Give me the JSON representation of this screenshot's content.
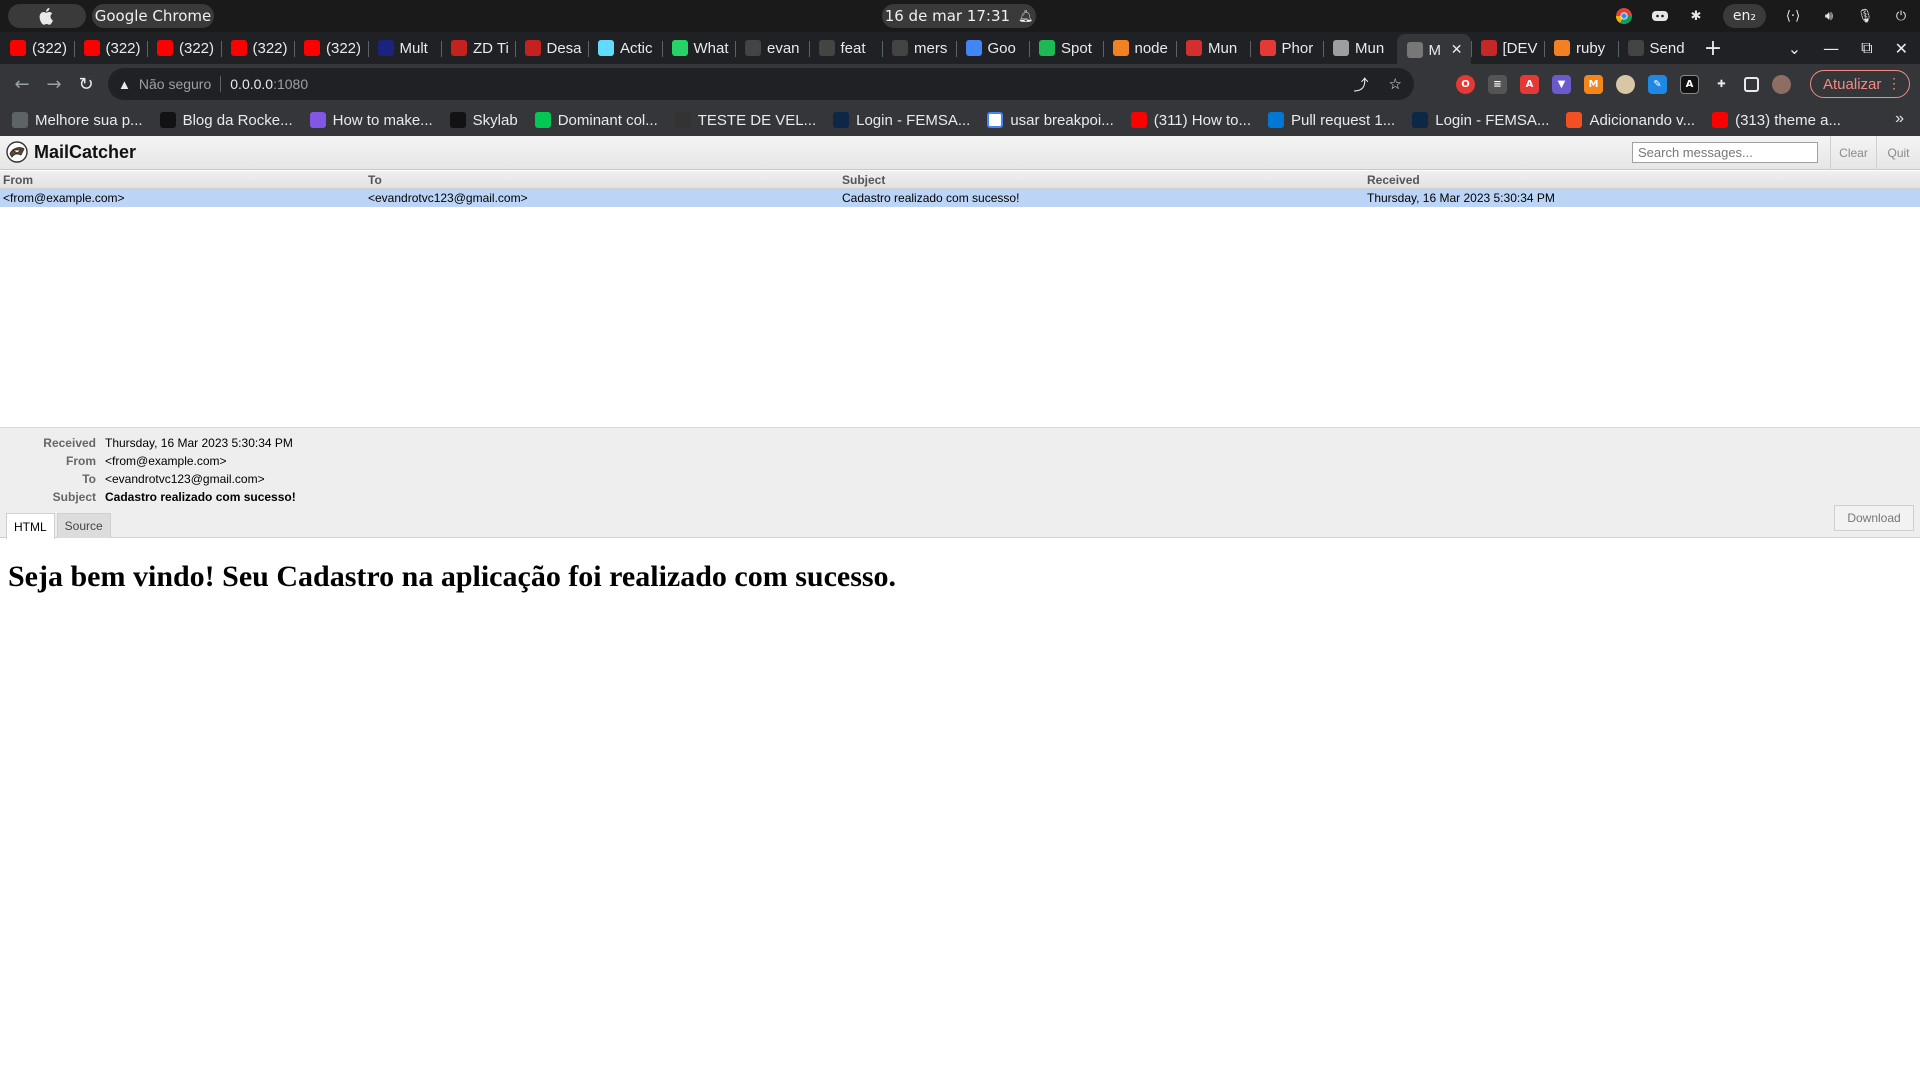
{
  "os_bar": {
    "app_name": "Google Chrome",
    "clock": "16 de mar  17:31",
    "language": "en₂"
  },
  "tabs": [
    {
      "label": "(322)",
      "icon": "youtube-icon",
      "color": "#ff0000"
    },
    {
      "label": "(322)",
      "icon": "youtube-icon",
      "color": "#ff0000"
    },
    {
      "label": "(322)",
      "icon": "youtube-icon",
      "color": "#ff0000"
    },
    {
      "label": "(322)",
      "icon": "youtube-icon",
      "color": "#ff0000"
    },
    {
      "label": "(322)",
      "icon": "youtube-icon",
      "color": "#ff0000"
    },
    {
      "label": "Mult",
      "icon": "m-icon",
      "color": "#1a237e"
    },
    {
      "label": "ZD Ti",
      "icon": "gmail-icon",
      "color": "#c5221f"
    },
    {
      "label": "Desa",
      "icon": "gmail-icon",
      "color": "#c5221f"
    },
    {
      "label": "Actic",
      "icon": "react-icon",
      "color": "#61dafb"
    },
    {
      "label": "What",
      "icon": "whatsapp-icon",
      "color": "#25d366"
    },
    {
      "label": "evan",
      "icon": "github-icon",
      "color": "#444444"
    },
    {
      "label": "feat",
      "icon": "github-icon",
      "color": "#444444"
    },
    {
      "label": "mers",
      "icon": "github-icon",
      "color": "#444444"
    },
    {
      "label": "Goo",
      "icon": "translate-icon",
      "color": "#4285f4"
    },
    {
      "label": "Spot",
      "icon": "spotify-icon",
      "color": "#1db954"
    },
    {
      "label": "node",
      "icon": "stackoverflow-icon",
      "color": "#f48024"
    },
    {
      "label": "Mun",
      "icon": "mun-icon",
      "color": "#d32f2f"
    },
    {
      "label": "Phor",
      "icon": "phone-icon",
      "color": "#e53935"
    },
    {
      "label": "Mun",
      "icon": "globe-icon",
      "color": "#9e9e9e"
    },
    {
      "label": "M",
      "icon": "mailcatcher-icon",
      "color": "#777777",
      "active": true
    },
    {
      "label": "[DEV",
      "icon": "dev-icon",
      "color": "#c62828"
    },
    {
      "label": "ruby",
      "icon": "stackoverflow-icon",
      "color": "#f48024"
    },
    {
      "label": "Send",
      "icon": "github-icon",
      "color": "#444444"
    }
  ],
  "omnibox": {
    "security_label": "Não seguro",
    "host": "0.0.0.0",
    "port": ":1080"
  },
  "update_button": "Atualizar",
  "bookmarks": [
    {
      "label": "Melhore sua p...",
      "icon": "people-icon",
      "color": "#5f6368"
    },
    {
      "label": "Blog da Rocke...",
      "icon": "rocketseat-icon",
      "color": "#121214"
    },
    {
      "label": "How to make...",
      "icon": "dev-icon",
      "color": "#8257e5"
    },
    {
      "label": "Skylab",
      "icon": "skylab-icon",
      "color": "#121214"
    },
    {
      "label": "Dominant col...",
      "icon": "r-icon",
      "color": "#00c853"
    },
    {
      "label": "TESTE DE VEL...",
      "icon": "speedtest-icon",
      "color": "#333333"
    },
    {
      "label": "Login - FEMSA...",
      "icon": "femsa-icon",
      "color": "#0d2847"
    },
    {
      "label": "usar breakpoi...",
      "icon": "google-icon",
      "color": "#ffffff"
    },
    {
      "label": "(311) How to...",
      "icon": "youtube-icon",
      "color": "#ff0000"
    },
    {
      "label": "Pull request 1...",
      "icon": "azure-devops-icon",
      "color": "#0078d4"
    },
    {
      "label": "Login - FEMSA...",
      "icon": "femsa-icon",
      "color": "#0d2847"
    },
    {
      "label": "Adicionando v...",
      "icon": "microsoft-icon",
      "color": "#f25022"
    },
    {
      "label": "(313) theme a...",
      "icon": "youtube-icon",
      "color": "#ff0000"
    }
  ],
  "mailcatcher": {
    "title": "MailCatcher",
    "search_placeholder": "Search messages...",
    "clear_label": "Clear",
    "quit_label": "Quit",
    "columns": {
      "from": "From",
      "to": "To",
      "subject": "Subject",
      "received": "Received"
    },
    "messages": [
      {
        "from": "<from@example.com>",
        "to": "<evandrotvc123@gmail.com>",
        "subject": "Cadastro realizado com sucesso!",
        "received": "Thursday, 16 Mar 2023 5:30:34 PM"
      }
    ],
    "detail": {
      "received_label": "Received",
      "received": "Thursday, 16 Mar 2023 5:30:34 PM",
      "from_label": "From",
      "from": "<from@example.com>",
      "to_label": "To",
      "to": "<evandrotvc123@gmail.com>",
      "subject_label": "Subject",
      "subject": "Cadastro realizado com sucesso!",
      "tab_html": "HTML",
      "tab_source": "Source",
      "download_label": "Download",
      "body_heading": "Seja bem vindo! Seu Cadastro na aplicação foi realizado com sucesso."
    }
  }
}
